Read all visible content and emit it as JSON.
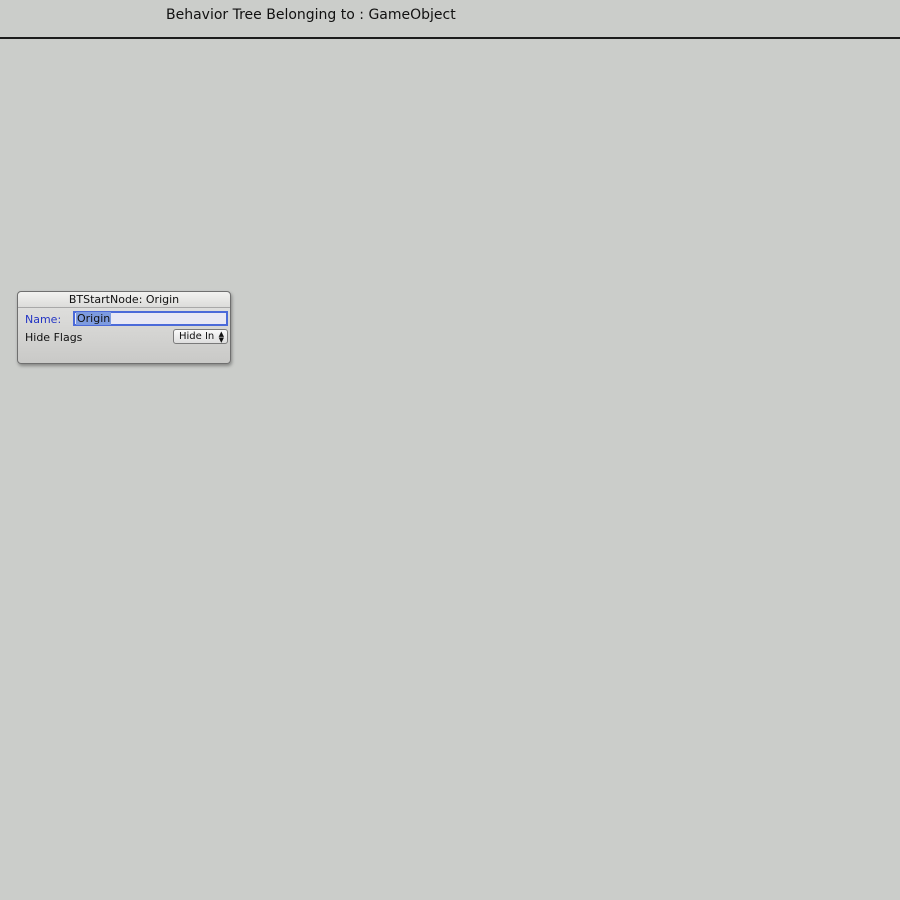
{
  "header": {
    "title": "Behavior Tree Belonging to : GameObject"
  },
  "node": {
    "title": "BTStartNode: Origin",
    "name_label": "Name:",
    "name_value": "Origin",
    "hide_flags_label": "Hide Flags",
    "hide_flags_value": "Hide In"
  },
  "colors": {
    "background": "#cbcdca",
    "label_accent": "#2435c4",
    "selection": "#7d9be0",
    "focus_border": "#4b6ad9"
  },
  "icons": {
    "popup_arrows": "up-down-arrows-icon"
  }
}
